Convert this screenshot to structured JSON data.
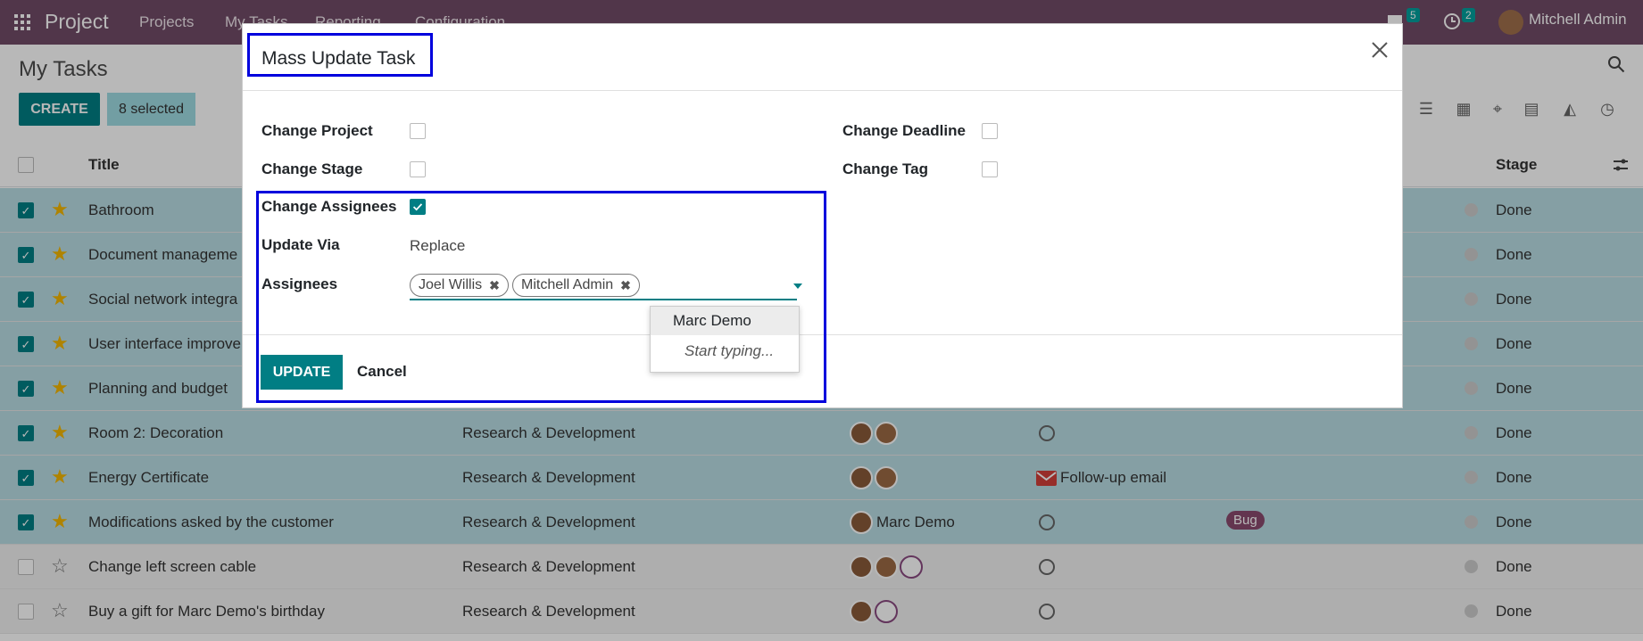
{
  "navbar": {
    "brand": "Project",
    "menu": [
      "Projects",
      "My Tasks",
      "Reporting",
      "Configuration"
    ],
    "messages_count": "5",
    "activities_count": "2",
    "user_name": "Mitchell Admin"
  },
  "control_panel": {
    "breadcrumb": "My Tasks",
    "create_label": "CREATE",
    "selected_label": "8 selected"
  },
  "list": {
    "headers": {
      "title": "Title",
      "stage": "Stage"
    },
    "rows": [
      {
        "title": "Bathroom",
        "project": "",
        "stage": "Done",
        "selected": true,
        "starred": true
      },
      {
        "title": "Document manageme",
        "project": "",
        "stage": "Done",
        "selected": true,
        "starred": true
      },
      {
        "title": "Social network integra",
        "project": "",
        "stage": "Done",
        "selected": true,
        "starred": true
      },
      {
        "title": "User interface improve",
        "project": "",
        "stage": "Done",
        "selected": true,
        "starred": true
      },
      {
        "title": "Planning and budget",
        "project": "",
        "stage": "Done",
        "selected": true,
        "starred": true
      },
      {
        "title": "Room 2: Decoration",
        "project": "Research & Development",
        "stage": "Done",
        "selected": true,
        "starred": true
      },
      {
        "title": "Energy Certificate",
        "project": "Research & Development",
        "activity": "Follow-up email",
        "stage": "Done",
        "selected": true,
        "starred": true
      },
      {
        "title": "Modifications asked by the customer",
        "project": "Research & Development",
        "assignee": "Marc Demo",
        "tag": "Bug",
        "stage": "Done",
        "selected": true,
        "starred": true
      },
      {
        "title": "Change left screen cable",
        "project": "Research & Development",
        "stage": "Done",
        "selected": false,
        "starred": false
      },
      {
        "title": "Buy a gift for Marc Demo's birthday",
        "project": "Research & Development",
        "stage": "Done",
        "selected": false,
        "starred": false
      }
    ]
  },
  "modal": {
    "title": "Mass Update Task",
    "fields": {
      "change_project": "Change Project",
      "change_stage": "Change Stage",
      "change_assignees": "Change Assignees",
      "update_via": "Update Via",
      "update_via_value": "Replace",
      "assignees": "Assignees",
      "change_deadline": "Change Deadline",
      "change_tag": "Change Tag"
    },
    "assignee_tags": [
      "Joel Willis",
      "Mitchell Admin"
    ],
    "dropdown": {
      "option": "Marc Demo",
      "hint": "Start typing..."
    },
    "update_label": "UPDATE",
    "cancel_label": "Cancel"
  },
  "colors": {
    "navbar": "#714b67",
    "primary": "#017e84",
    "selected_row": "#b9dde4",
    "highlight": "#0000dd"
  }
}
